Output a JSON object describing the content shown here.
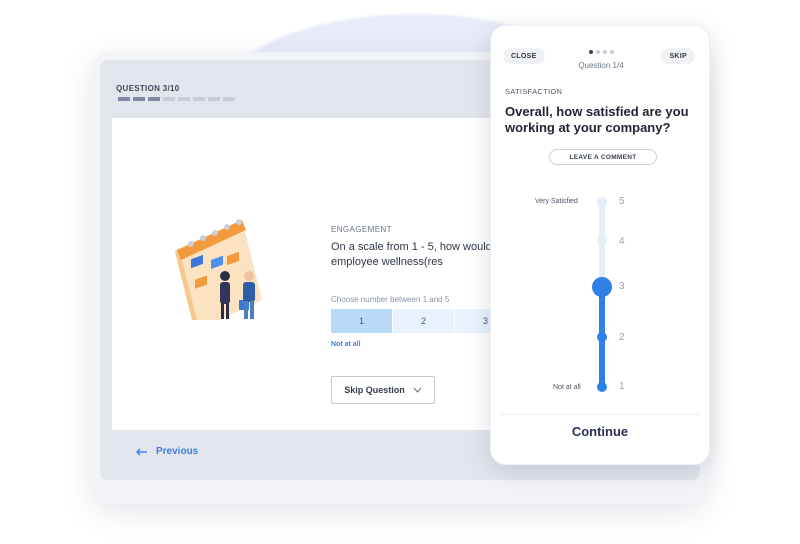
{
  "desktop": {
    "question_counter": "QUESTION 3/10",
    "progress": {
      "completed": 3,
      "total": 10
    },
    "section_label": "ENGAGEMENT",
    "question_text": "On a scale from 1 - 5, how would you promote employee wellness(res",
    "hint": "Choose number between 1 and 5",
    "scale_options": [
      "1",
      "2",
      "3"
    ],
    "selected_option": "1",
    "not_at_all": "Not at all",
    "skip_label": "Skip Question",
    "previous_label": "Previous"
  },
  "phone": {
    "close_label": "CLOSE",
    "skip_label": "SKIP",
    "question_count": "Question 1/4",
    "section_label": "SATISFACTION",
    "question_text": "Overall, how satisfied are you working at your company?",
    "comment_label": "LEAVE A COMMENT",
    "very_satisfied": "Very Satisfied",
    "not_at_all": "Not at all",
    "scale_numbers": [
      "5",
      "4",
      "3",
      "2",
      "1"
    ],
    "selected_value": 3,
    "continue_label": "Continue"
  },
  "colors": {
    "accent_blue": "#2f80e6",
    "light_blue": "#d6e8fb",
    "dark_text": "#1f2533"
  }
}
